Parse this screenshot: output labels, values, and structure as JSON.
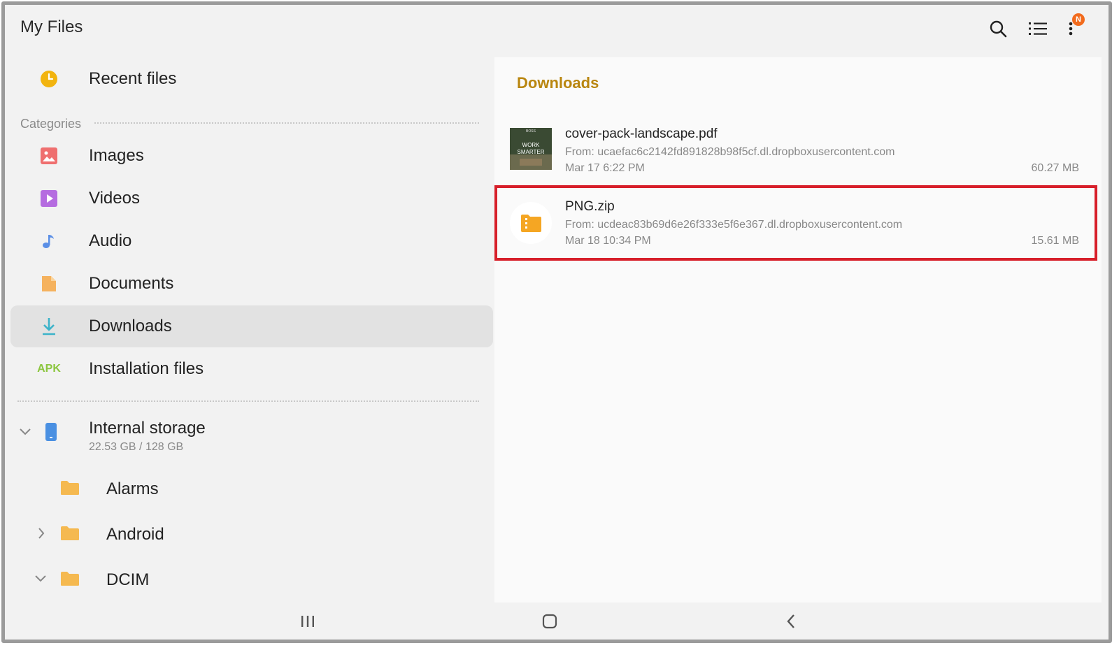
{
  "app": {
    "title": "My Files"
  },
  "toolbar": {
    "badge": "N"
  },
  "sidebar": {
    "recent": "Recent files",
    "categories_label": "Categories",
    "categories": [
      {
        "label": "Images",
        "icon": "image-icon"
      },
      {
        "label": "Videos",
        "icon": "video-icon"
      },
      {
        "label": "Audio",
        "icon": "music-note-icon"
      },
      {
        "label": "Documents",
        "icon": "document-icon"
      },
      {
        "label": "Downloads",
        "icon": "download-icon",
        "selected": true
      },
      {
        "label": "Installation files",
        "icon": "apk-icon",
        "icon_text": "APK"
      }
    ],
    "storage": {
      "name": "Internal storage",
      "usage": "22.53 GB / 128 GB"
    },
    "folders": [
      {
        "label": "Alarms"
      },
      {
        "label": "Android"
      },
      {
        "label": "DCIM"
      }
    ]
  },
  "content": {
    "title": "Downloads",
    "thumb_text": {
      "top": "BOSS",
      "line1": "WORK",
      "line2": "SMARTER"
    },
    "files": [
      {
        "name": "cover-pack-landscape.pdf",
        "source": "From: ucaefac6c2142fd891828b98f5cf.dl.dropboxusercontent.com",
        "date": "Mar 17 6:22 PM",
        "size": "60.27 MB"
      },
      {
        "name": "PNG.zip",
        "source": "From: ucdeac83b69d6e26f333e5f6e367.dl.dropboxusercontent.com",
        "date": "Mar 18 10:34 PM",
        "size": "15.61 MB"
      }
    ]
  },
  "colors": {
    "accent": "#b9860f",
    "highlight": "#d71f2a",
    "selected_bg": "#e2e2e2"
  }
}
